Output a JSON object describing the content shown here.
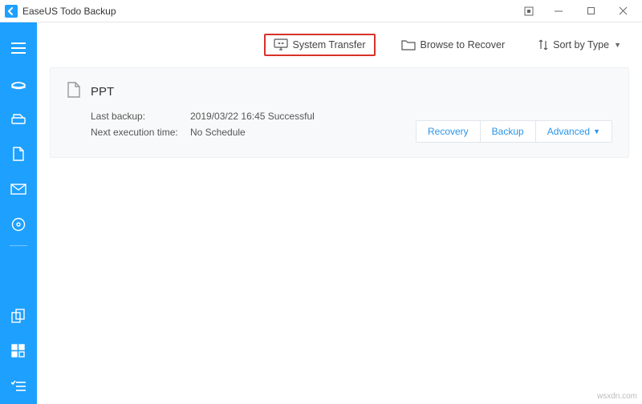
{
  "window": {
    "title": "EaseUS Todo Backup"
  },
  "toolbar": {
    "system_transfer": "System Transfer",
    "browse_recover": "Browse to Recover",
    "sort_by_type": "Sort by Type"
  },
  "card": {
    "name": "PPT",
    "labels": {
      "last_backup": "Last backup:",
      "next_exec": "Next execution time:"
    },
    "values": {
      "last_backup": "2019/03/22 16:45 Successful",
      "next_exec": "No Schedule"
    },
    "actions": {
      "recovery": "Recovery",
      "backup": "Backup",
      "advanced": "Advanced"
    }
  },
  "watermark": "wsxdn.com"
}
